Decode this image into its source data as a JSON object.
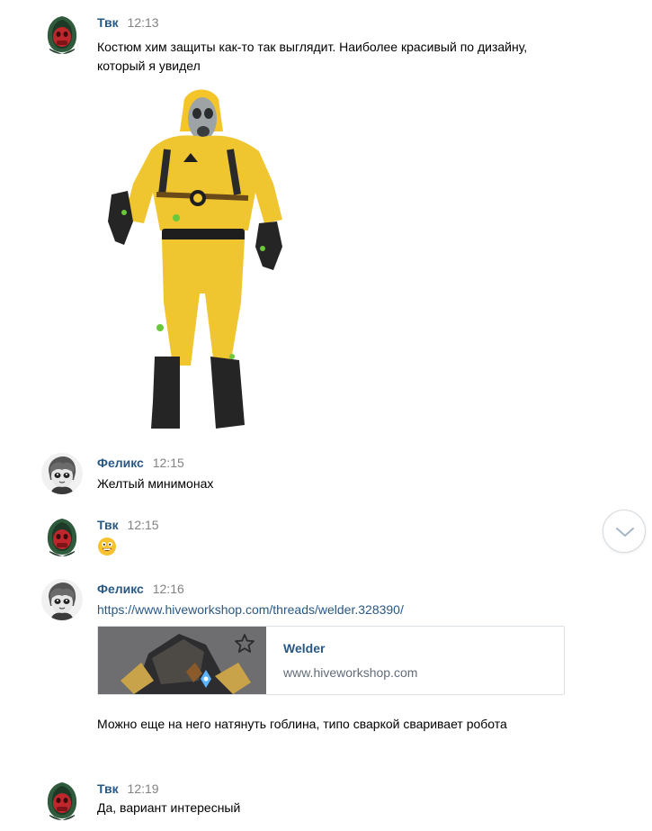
{
  "messages": [
    {
      "author": "Твк",
      "time": "12:13",
      "text": "Костюм хим защиты как-то так выглядит. Наиболее красивый по дизайну, который я увидел",
      "avatar": "hooded-figure-red-mask",
      "attachment": "hazmat-suit-photo"
    },
    {
      "author": "Феликс",
      "time": "12:15",
      "text": "Желтый минимонах",
      "avatar": "anime-character-grayscale"
    },
    {
      "author": "Твк",
      "time": "12:15",
      "emoji": "grinning-face-emoji",
      "avatar": "hooded-figure-red-mask"
    },
    {
      "author": "Феликс",
      "time": "12:16",
      "link": "https://www.hiveworkshop.com/threads/welder.328390/",
      "snippet": {
        "title": "Welder",
        "host": "www.hiveworkshop.com"
      },
      "text": "Можно еще на него натянуть гоблина, типо сваркой сваривает робота",
      "avatar": "anime-character-grayscale"
    },
    {
      "author": "Твк",
      "time": "12:19",
      "text": "Да, вариант интересный",
      "avatar": "hooded-figure-red-mask"
    }
  ],
  "controls": {
    "scroll_down_icon": "chevron-down-icon"
  },
  "colors": {
    "author": "#2a5885",
    "time": "#828282",
    "link": "#2a5885",
    "border": "#dce1e6"
  }
}
